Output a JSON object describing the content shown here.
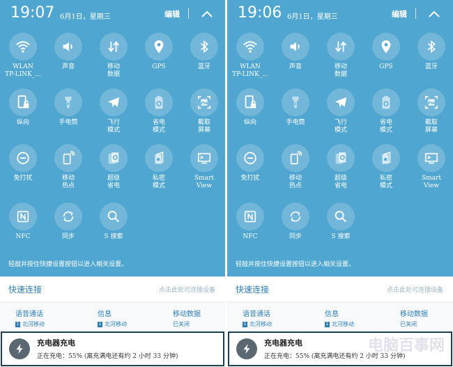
{
  "left": {
    "time": "19:07",
    "date": "6月1日，星期三",
    "edit_label": "编辑",
    "tiles": [
      {
        "label": "WLAN\nTP-LINK_..."
      },
      {
        "label": "声音"
      },
      {
        "label": "移动\n数据"
      },
      {
        "label": "GPS"
      },
      {
        "label": "蓝牙"
      },
      {
        "label": "纵向"
      },
      {
        "label": "手电筒"
      },
      {
        "label": "飞行\n模式"
      },
      {
        "label": "省电\n模式"
      },
      {
        "label": "截取\n屏幕"
      },
      {
        "label": "免打扰"
      },
      {
        "label": "移动\n热点"
      },
      {
        "label": "超级\n省电"
      },
      {
        "label": "私密\n模式"
      },
      {
        "label": "Smart\nView"
      },
      {
        "label": "NFC"
      },
      {
        "label": "同步"
      },
      {
        "label": "S 搜索"
      }
    ],
    "hint": "轻敲并按住快捷设置按钮以进入相关设置。",
    "quick_connect": {
      "title": "快速连接",
      "hint": "点击此处可连接设备"
    },
    "sim_bar": {
      "voice": {
        "label": "语音通话",
        "sub": "北河移动",
        "badge": "1"
      },
      "message": {
        "label": "信息",
        "sub": "北河移动",
        "badge": "1"
      },
      "data": {
        "label": "移动数据",
        "sub": "已关闭"
      }
    },
    "charging": {
      "title": "充电器充电",
      "status": "正在充电：55% (离充满电还有约 2 小时 33 分钟)"
    }
  },
  "right": {
    "time": "19:06",
    "date": "6月1日，星期三",
    "edit_label": "编辑",
    "tiles": [
      {
        "label": "WLAN\nTP-LINK_..."
      },
      {
        "label": "声音"
      },
      {
        "label": "移动\n数据"
      },
      {
        "label": "GPS"
      },
      {
        "label": "蓝牙"
      },
      {
        "label": "纵向"
      },
      {
        "label": "手电筒"
      },
      {
        "label": "飞行\n模式"
      },
      {
        "label": "省电\n模式"
      },
      {
        "label": "截取\n屏幕"
      },
      {
        "label": "免打扰"
      },
      {
        "label": "移动\n热点"
      },
      {
        "label": "超级\n省电"
      },
      {
        "label": "私密\n模式"
      },
      {
        "label": "Smart\nView"
      },
      {
        "label": "NFC"
      },
      {
        "label": "同步"
      },
      {
        "label": "S 搜索"
      }
    ],
    "hint": "轻敲并按住快捷设置按钮以进入相关设置。",
    "quick_connect": {
      "title": "快速连接",
      "hint": "点击此处可连接设备"
    },
    "sim_bar": {
      "voice": {
        "label": "语音通话",
        "sub": "北河移动",
        "badge": "1"
      },
      "message": {
        "label": "信息",
        "sub": "北河移动",
        "badge": "1"
      },
      "data": {
        "label": "移动数据",
        "sub": "已关闭"
      }
    },
    "charging": {
      "title": "充电器充电",
      "status": "正在充电：55% (离充满电还有约 2 小时 33 分钟)"
    }
  },
  "icons": [
    "wifi-icon",
    "sound-icon",
    "mobile-data-icon",
    "gps-icon",
    "bluetooth-icon",
    "portrait-lock-icon",
    "flashlight-icon",
    "airplane-icon",
    "power-saving-icon",
    "screenshot-icon",
    "do-not-disturb-icon",
    "hotspot-icon",
    "ultra-power-saving-icon",
    "private-mode-icon",
    "smart-view-icon",
    "nfc-icon",
    "sync-icon",
    "s-finder-icon",
    "charging-bolt-icon"
  ],
  "colors": {
    "panel_bg": "#4fa6d0",
    "accent": "#2f7fb8"
  },
  "watermark": "电脑百事网"
}
